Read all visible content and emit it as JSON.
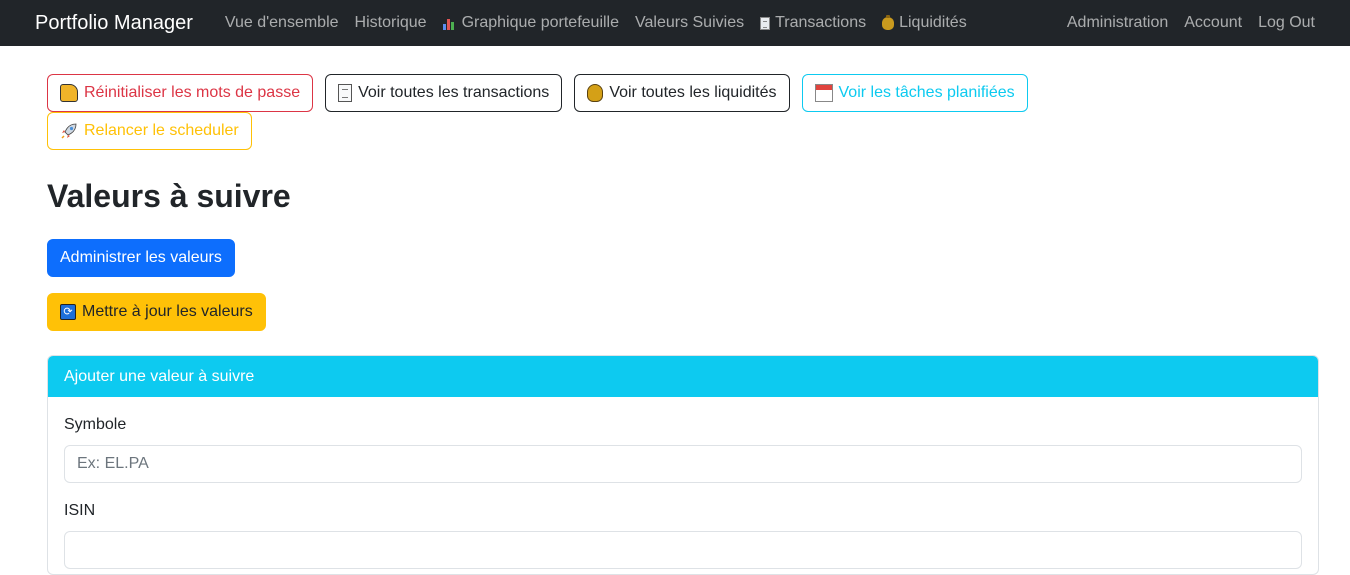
{
  "navbar": {
    "brand": "Portfolio Manager",
    "links": [
      {
        "label": "Vue d'ensemble",
        "icon": null
      },
      {
        "label": "Historique",
        "icon": null
      },
      {
        "label": "Graphique portefeuille",
        "icon": "bar-chart-icon"
      },
      {
        "label": "Valeurs Suivies",
        "icon": null
      },
      {
        "label": "Transactions",
        "icon": "document-icon"
      },
      {
        "label": "Liquidités",
        "icon": "money-bag-icon"
      }
    ],
    "right_links": [
      "Administration",
      "Account",
      "Log Out"
    ]
  },
  "actions": {
    "reset_passwords": "Réinitialiser les mots de passe",
    "view_transactions": "Voir toutes les transactions",
    "view_liquidities": "Voir toutes les liquidités",
    "view_tasks": "Voir les tâches planifiées",
    "restart_scheduler": "Relancer le scheduler"
  },
  "page": {
    "title": "Valeurs à suivre",
    "manage_button": "Administrer les valeurs",
    "update_button": "Mettre à jour les valeurs"
  },
  "form": {
    "header": "Ajouter une valeur à suivre",
    "symbol_label": "Symbole",
    "symbol_placeholder": "Ex: EL.PA",
    "isin_label": "ISIN"
  },
  "colors": {
    "navbar_bg": "#212529",
    "primary": "#0d6efd",
    "warning": "#ffc107",
    "info": "#0dcaf0",
    "danger": "#dc3545"
  }
}
